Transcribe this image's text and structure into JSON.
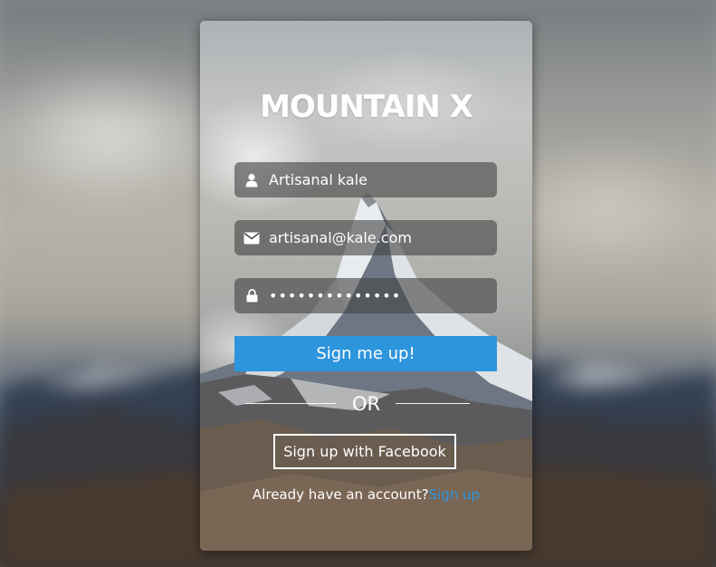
{
  "app": {
    "title": "MOUNTAIN X"
  },
  "form": {
    "name_value": "Artisanal kale",
    "email_value": "artisanal@kale.com",
    "password_value": "••••••••••••••",
    "submit_label": "Sign me up!",
    "divider_label": "OR",
    "facebook_label": "Sign up with Facebook",
    "login_prompt": "Already have an account?",
    "login_link": "Sign up"
  },
  "icons": {
    "name": "user-icon",
    "email": "envelope-icon",
    "password": "lock-icon"
  },
  "colors": {
    "accent": "#2d95dc",
    "field_bg": "#464646",
    "text": "#ffffff"
  }
}
